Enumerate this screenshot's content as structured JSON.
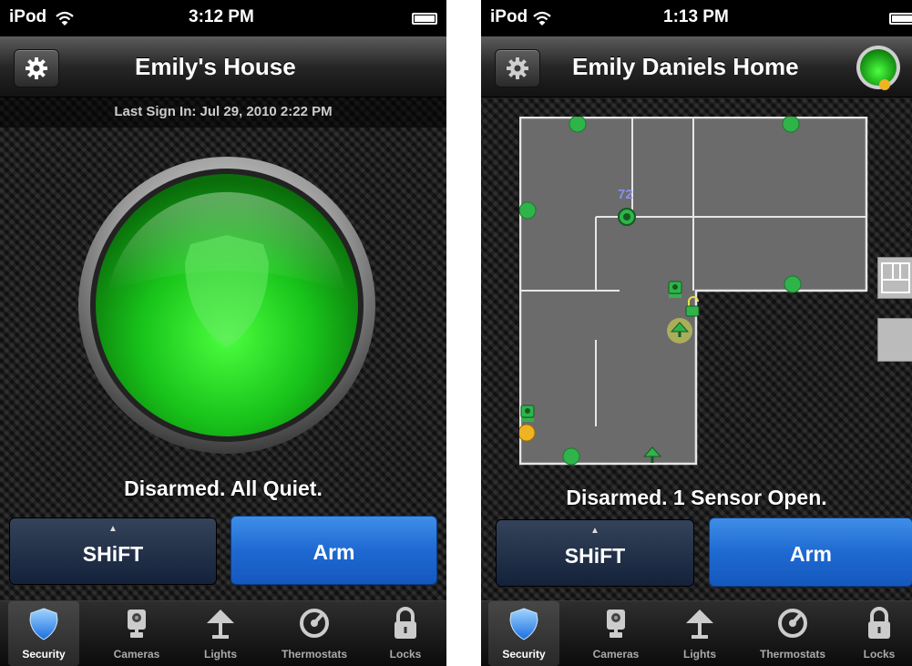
{
  "left_screen": {
    "status_bar": {
      "carrier": "iPod",
      "time": "3:12 PM"
    },
    "nav_title": "Emily's House",
    "last_sign_in": "Last Sign In: Jul 29, 2010 2:22 PM",
    "status_message": "Disarmed. All Quiet.",
    "shift_label": "SHiFT",
    "arm_label": "Arm",
    "tabs": [
      {
        "label": "Security",
        "icon": "shield-icon",
        "active": true
      },
      {
        "label": "Cameras",
        "icon": "camera-icon"
      },
      {
        "label": "Lights",
        "icon": "lamp-icon"
      },
      {
        "label": "Thermostats",
        "icon": "thermostat-icon"
      },
      {
        "label": "Locks",
        "icon": "lock-icon"
      }
    ],
    "colors": {
      "armed_indicator": "#1faa1f",
      "arm_button": "#1e6ad2"
    }
  },
  "right_screen": {
    "status_bar": {
      "carrier": "iPod",
      "time": "1:13 PM"
    },
    "nav_title": "Emily Daniels Home",
    "temperature_label": "72",
    "status_message": "Disarmed. 1 Sensor Open.",
    "shift_label": "SHiFT",
    "arm_label": "Arm",
    "tabs": [
      {
        "label": "Security",
        "icon": "shield-icon",
        "active": true
      },
      {
        "label": "Cameras",
        "icon": "camera-icon"
      },
      {
        "label": "Lights",
        "icon": "lamp-icon"
      },
      {
        "label": "Thermostats",
        "icon": "thermostat-icon"
      },
      {
        "label": "Locks",
        "icon": "lock-icon"
      }
    ],
    "colors": {
      "sensor_ok": "#2fb44a",
      "sensor_open": "#f0b323"
    }
  }
}
